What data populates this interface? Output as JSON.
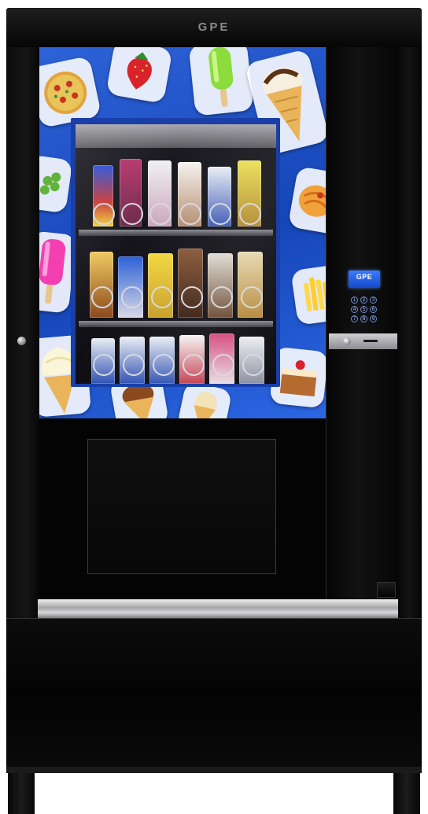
{
  "machine": {
    "brand": "GPE",
    "screen_label": "GPE",
    "keypad_keys": [
      "1",
      "2",
      "3",
      "4",
      "5",
      "6",
      "7",
      "8",
      "9"
    ]
  },
  "colors": {
    "cabinet": "#050505",
    "wrap_blue": "#1e56d2",
    "screen_blue": "#2e6cf0",
    "steel": "#c4c4c7"
  }
}
